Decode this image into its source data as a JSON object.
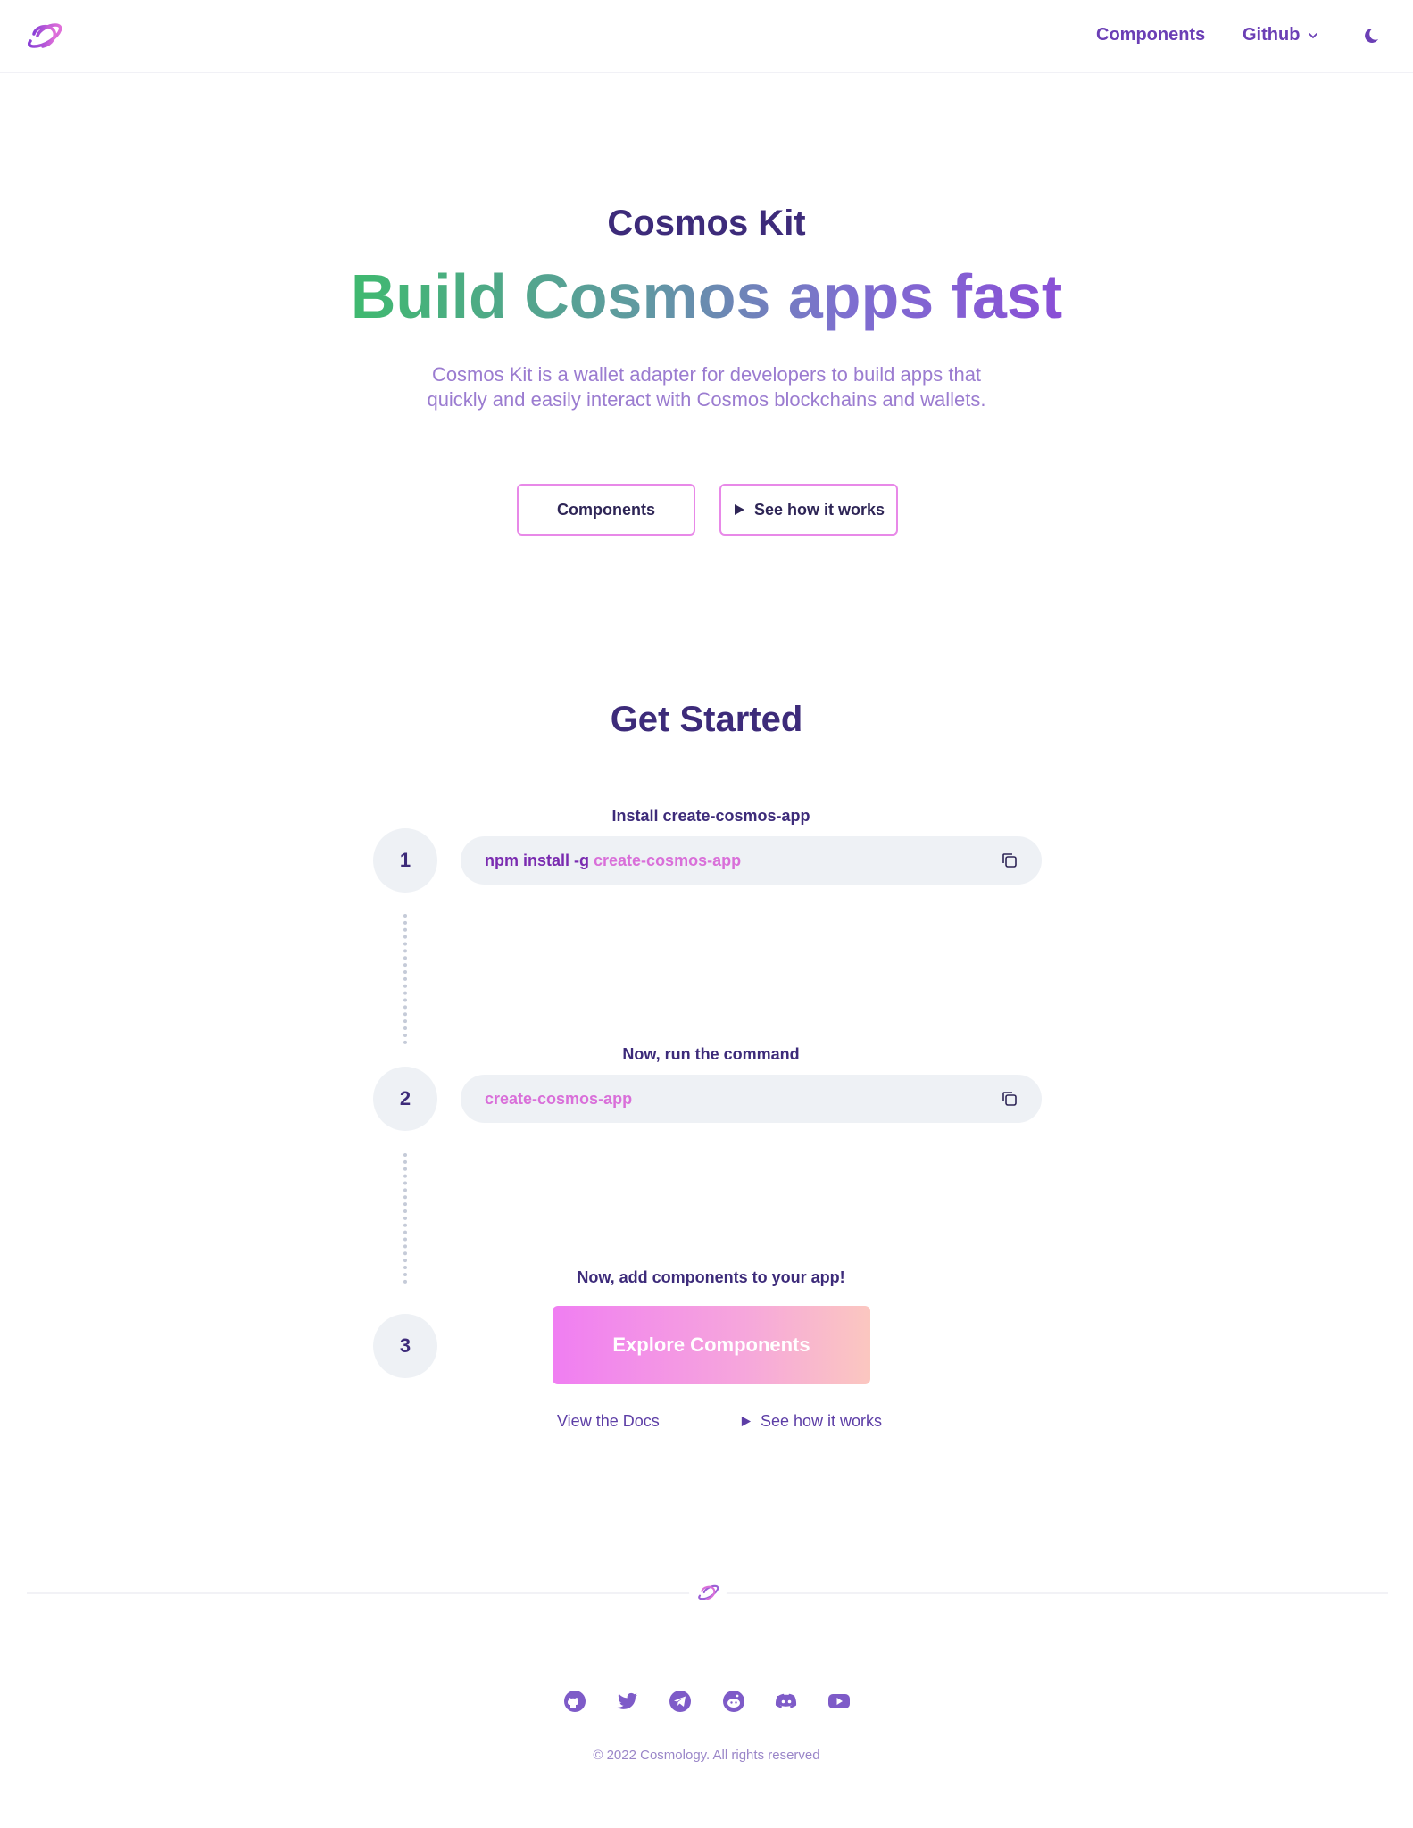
{
  "header": {
    "nav_components": "Components",
    "nav_github": "Github"
  },
  "hero": {
    "kicker": "Cosmos Kit",
    "title": "Build Cosmos apps fast",
    "description": "Cosmos Kit is a wallet adapter for developers to build apps that quickly and easily interact with Cosmos blockchains and wallets.",
    "btn_components": "Components",
    "btn_how": "See how it works"
  },
  "get_started": {
    "title": "Get Started",
    "steps": [
      {
        "number": "1",
        "label": "Install create-cosmos-app",
        "code_prefix": "npm install -g ",
        "code_pkg": "create-cosmos-app"
      },
      {
        "number": "2",
        "label": "Now, run the command",
        "code_prefix": "",
        "code_pkg": "create-cosmos-app"
      },
      {
        "number": "3",
        "label": "Now, add components to your app!"
      }
    ],
    "explore_button": "Explore Components",
    "link_docs": "View the Docs",
    "link_how": "See how it works"
  },
  "footer": {
    "copyright": "© 2022 Cosmology. All rights reserved"
  },
  "colors": {
    "primary": "#6b3fb5",
    "heading": "#3d2b7a",
    "accent_pink": "#e889e8",
    "code_bg": "#eef1f5"
  },
  "icons": [
    "planet-logo-icon",
    "chevron-down-icon",
    "moon-icon",
    "play-icon",
    "copy-icon",
    "github-icon",
    "twitter-icon",
    "telegram-icon",
    "reddit-icon",
    "discord-icon",
    "youtube-icon"
  ]
}
